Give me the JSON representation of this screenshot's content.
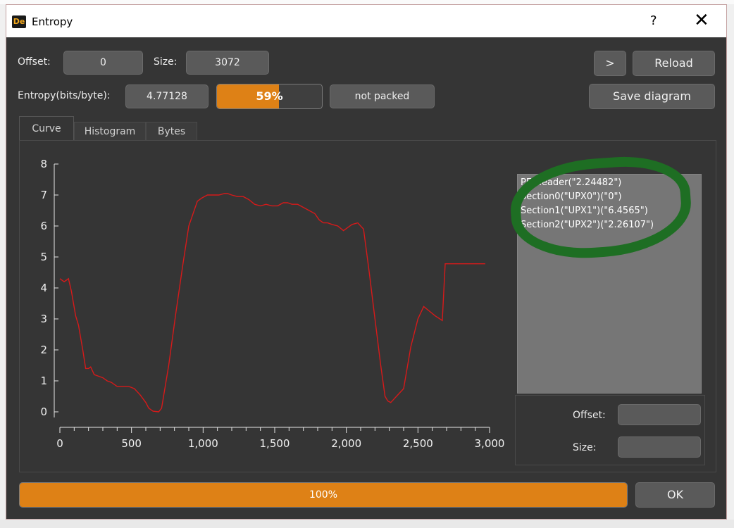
{
  "window": {
    "title": "Entropy",
    "app_icon_text": "De",
    "help_label": "?",
    "close_label": "✕"
  },
  "toolbar": {
    "offset_label": "Offset:",
    "offset_value": "0",
    "size_label": "Size:",
    "size_value": "3072",
    "entropy_label": "Entropy(bits/byte):",
    "entropy_value": "4.77128",
    "entropy_percent": 59,
    "entropy_percent_text": "59%",
    "packed_status": "not packed",
    "next_label": ">",
    "reload_label": "Reload",
    "save_label": "Save diagram"
  },
  "tabs": [
    {
      "label": "Curve",
      "active": true
    },
    {
      "label": "Histogram",
      "active": false
    },
    {
      "label": "Bytes",
      "active": false
    }
  ],
  "sections": [
    "PE Header(\"2.24482\")",
    "Section0(\"UPX0\")(\"0\")",
    "Section1(\"UPX1\")(\"6.4565\")",
    "Section2(\"UPX2\")(\"2.26107\")"
  ],
  "side": {
    "offset_label": "Offset:",
    "offset_value": "",
    "size_label": "Size:",
    "size_value": ""
  },
  "bottom": {
    "progress": 100,
    "progress_text": "100%",
    "ok_label": "OK"
  },
  "colors": {
    "accent": "#de8116",
    "curve": "#d61a1a",
    "highlight": "#1e6e23"
  },
  "chart_data": {
    "type": "line",
    "xlim": [
      0,
      3000
    ],
    "ylim": [
      0,
      8
    ],
    "x_ticks": [
      {
        "v": 0,
        "label": "0"
      },
      {
        "v": 500,
        "label": "500"
      },
      {
        "v": 1000,
        "label": "1,000"
      },
      {
        "v": 1500,
        "label": "1,500"
      },
      {
        "v": 2000,
        "label": "2,000"
      },
      {
        "v": 2500,
        "label": "2,500"
      },
      {
        "v": 3000,
        "label": "3,000"
      }
    ],
    "y_ticks": [
      {
        "v": 0,
        "label": "0"
      },
      {
        "v": 1,
        "label": "1"
      },
      {
        "v": 2,
        "label": "2"
      },
      {
        "v": 3,
        "label": "3"
      },
      {
        "v": 4,
        "label": "4"
      },
      {
        "v": 5,
        "label": "5"
      },
      {
        "v": 6,
        "label": "6"
      },
      {
        "v": 7,
        "label": "7"
      },
      {
        "v": 8,
        "label": "8"
      }
    ],
    "series": [
      {
        "x": [
          0,
          30,
          60,
          80,
          110,
          130,
          160,
          180,
          200,
          215,
          240,
          270,
          300,
          330,
          360,
          400,
          440,
          480,
          520,
          560,
          600,
          620,
          650,
          690,
          710,
          760,
          810,
          860,
          900,
          960,
          990,
          1030,
          1070,
          1110,
          1150,
          1170,
          1200,
          1240,
          1280,
          1320,
          1360,
          1400,
          1440,
          1480,
          1520,
          1560,
          1590,
          1620,
          1660,
          1700,
          1740,
          1780,
          1810,
          1840,
          1870,
          1900,
          1940,
          1980,
          2010,
          2040,
          2080,
          2120,
          2160,
          2200,
          2240,
          2270,
          2290,
          2310,
          2350,
          2400,
          2450,
          2500,
          2540,
          2580,
          2620,
          2670,
          2690,
          2720,
          2750,
          2800,
          2850,
          2900,
          2970
        ],
        "y": [
          4.3,
          4.2,
          4.3,
          3.9,
          3.1,
          2.8,
          2.0,
          1.4,
          1.4,
          1.45,
          1.2,
          1.15,
          1.1,
          1.0,
          0.95,
          0.82,
          0.82,
          0.82,
          0.75,
          0.55,
          0.3,
          0.12,
          0.02,
          0.0,
          0.12,
          1.5,
          3.2,
          4.8,
          6.0,
          6.8,
          6.9,
          7.0,
          7.0,
          7.0,
          7.05,
          7.05,
          7.0,
          6.95,
          6.95,
          6.85,
          6.7,
          6.65,
          6.7,
          6.65,
          6.65,
          6.75,
          6.75,
          6.7,
          6.7,
          6.6,
          6.5,
          6.4,
          6.2,
          6.1,
          6.1,
          6.05,
          6.0,
          5.85,
          5.95,
          6.05,
          6.1,
          5.9,
          4.5,
          3.0,
          1.5,
          0.5,
          0.35,
          0.3,
          0.5,
          0.75,
          2.1,
          3.0,
          3.4,
          3.25,
          3.1,
          2.95,
          4.78,
          4.78,
          4.78,
          4.78,
          4.78,
          4.78,
          4.78
        ]
      }
    ]
  }
}
